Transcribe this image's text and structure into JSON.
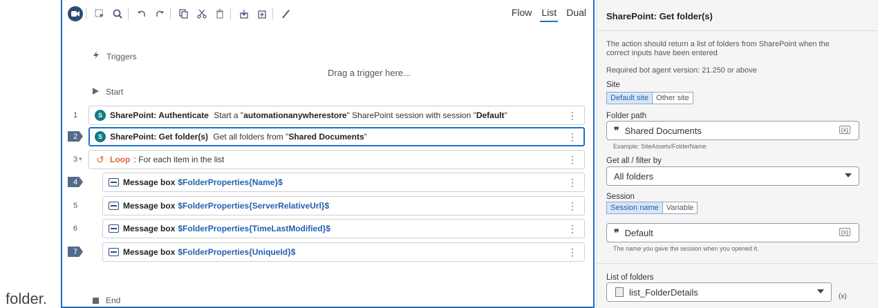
{
  "caption": "folder.",
  "toolbar": {
    "views": [
      "Flow",
      "List",
      "Dual"
    ],
    "active_view": "List",
    "icons": [
      "record-icon",
      "select-icon",
      "search-icon",
      "undo-icon",
      "redo-icon",
      "copy-icon",
      "cut-icon",
      "delete-icon",
      "enable-icon",
      "disable-icon",
      "wand-icon"
    ]
  },
  "canvas": {
    "triggers_label": "Triggers",
    "drag_hint": "Drag a trigger here...",
    "start_label": "Start",
    "end_label": "End",
    "lines": [
      {
        "num": "1",
        "badge": false,
        "indent": 0,
        "icon": "sharepoint-icon",
        "bold": "SharePoint: Authenticate",
        "parts": [
          " Start a \"",
          "automationanywherestore",
          "\" SharePoint session with session \"",
          "Default",
          "\""
        ],
        "selected": false
      },
      {
        "num": "2",
        "badge": true,
        "indent": 0,
        "icon": "sharepoint-icon",
        "bold": "SharePoint: Get folder(s)",
        "parts": [
          " Get all folders from \"",
          "Shared Documents",
          "\""
        ],
        "selected": true
      },
      {
        "num": "3",
        "badge": false,
        "indent": 0,
        "icon": "loop-icon",
        "loop": "Loop",
        "text": " : For each item in the list",
        "selected": false
      },
      {
        "num": "4",
        "badge": true,
        "indent": 1,
        "icon": "message-box-icon",
        "bold": "Message box",
        "var": "$FolderProperties{Name}$"
      },
      {
        "num": "5",
        "badge": false,
        "indent": 1,
        "icon": "message-box-icon",
        "bold": "Message box",
        "var": "$FolderProperties{ServerRelativeUrl}$"
      },
      {
        "num": "6",
        "badge": false,
        "indent": 1,
        "icon": "message-box-icon",
        "bold": "Message box",
        "var": "$FolderProperties{TimeLastModified}$"
      },
      {
        "num": "7",
        "badge": true,
        "indent": 1,
        "icon": "message-box-icon",
        "bold": "Message box",
        "var": "$FolderProperties{UniqueId}$"
      }
    ]
  },
  "props": {
    "title": "SharePoint: Get folder(s)",
    "description": "The action should return a list of folders from SharePoint when the correct inputs have been entered",
    "version": "Required bot agent version: 21.250 or above",
    "site": {
      "label": "Site",
      "options": [
        "Default site",
        "Other site"
      ],
      "selected": "Default site"
    },
    "folder_path": {
      "label": "Folder path",
      "value": "Shared Documents",
      "hint": "Example: SiteAssets/FolderName"
    },
    "filter": {
      "label": "Get all / filter by",
      "value": "All folders"
    },
    "session": {
      "label": "Session",
      "options": [
        "Session name",
        "Variable"
      ],
      "selected": "Session name",
      "value": "Default",
      "hint": "The name you gave the session when you opened it."
    },
    "output": {
      "label": "List of folders",
      "value": "list_FolderDetails"
    }
  },
  "colors": {
    "accent": "#1d6fc2",
    "loop": "#e8632b",
    "variable": "#2360b0",
    "sharepoint": "#0f7b83"
  }
}
